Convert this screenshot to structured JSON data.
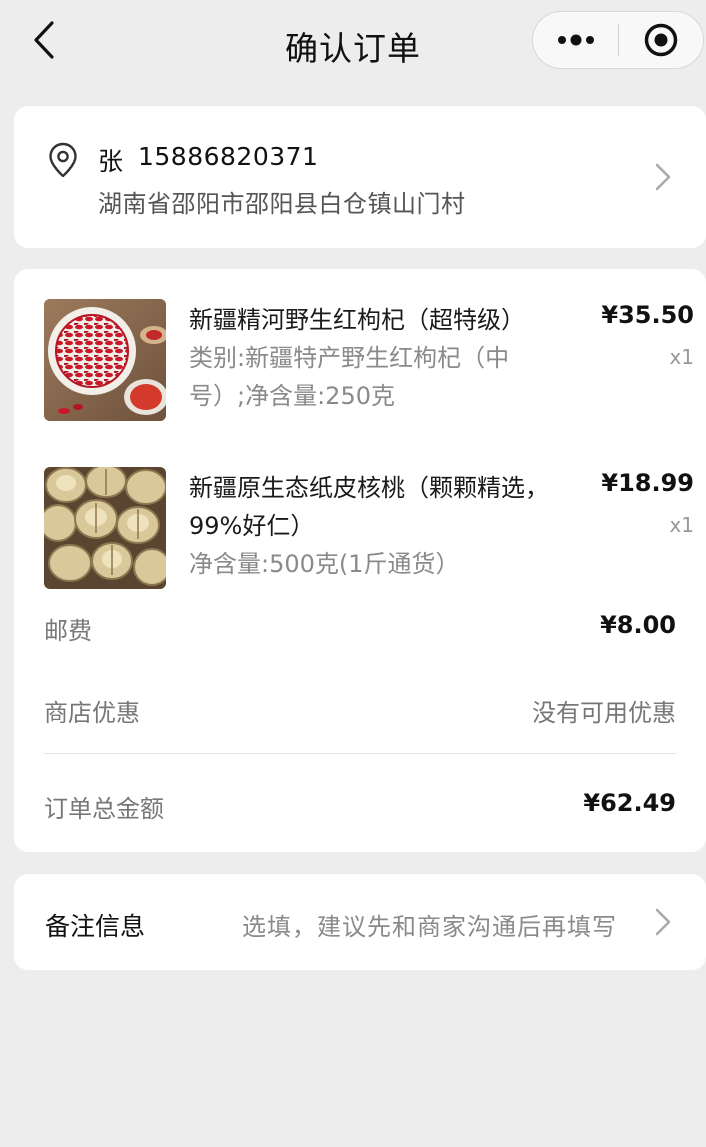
{
  "navbar": {
    "title": "确认订单",
    "back_icon": "chevron-left-icon",
    "more_icon": "more-dots-icon",
    "close_icon": "record-circle-icon"
  },
  "address": {
    "name": "张",
    "phone": "15886820371",
    "detail": "湖南省邵阳市邵阳县白仓镇山门村",
    "location_icon": "location-pin-icon",
    "chevron_icon": "chevron-right-icon"
  },
  "products": [
    {
      "name": "新疆精河野生红枸杞（超特级）",
      "spec": "类别:新疆特产野生红枸杞（中号）;净含量:250克",
      "price": "¥35.50",
      "qty": "x1",
      "thumb": "goji-berries-image"
    },
    {
      "name": "新疆原生态纸皮核桃（颗颗精选，99%好仁）",
      "spec": "净含量:500克(1斤通货）",
      "price": "¥18.99",
      "qty": "x1",
      "thumb": "walnuts-image"
    }
  ],
  "summary": {
    "shipping_label": "邮费",
    "shipping_value": "¥8.00",
    "discount_label": "商店优惠",
    "discount_value": "没有可用优惠",
    "total_label": "订单总金额",
    "total_value": "¥62.49"
  },
  "remark": {
    "label": "备注信息",
    "placeholder": "选填，建议先和商家沟通后再填写",
    "chevron_icon": "chevron-right-icon"
  },
  "colors": {
    "background": "#ededed",
    "card": "#ffffff",
    "text_primary": "#111111",
    "text_secondary": "#8a8a8a"
  }
}
